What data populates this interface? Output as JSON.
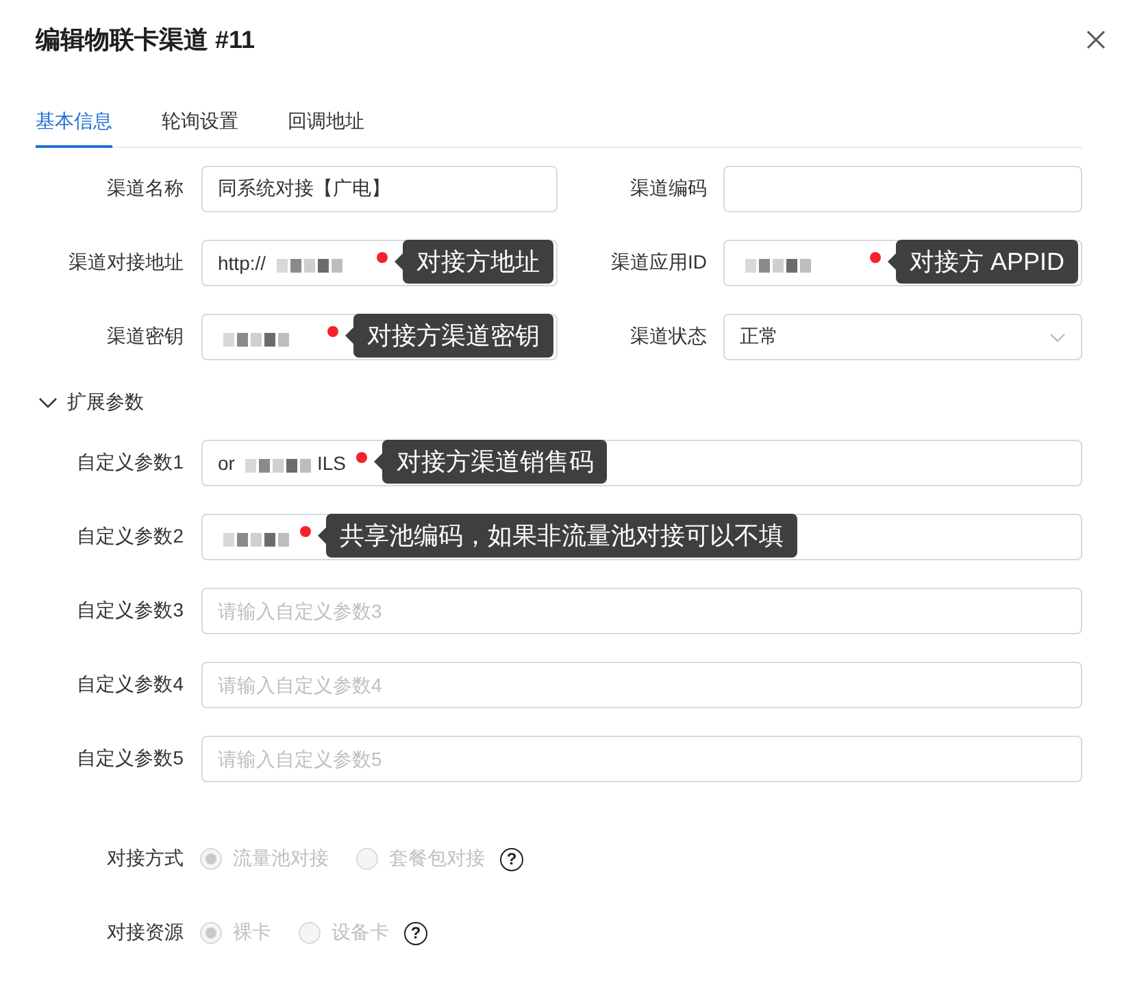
{
  "dialog": {
    "title": "编辑物联卡渠道 #11"
  },
  "tabs": [
    {
      "label": "基本信息",
      "selected": true
    },
    {
      "label": "轮询设置",
      "selected": false
    },
    {
      "label": "回调地址",
      "selected": false
    }
  ],
  "basic_fields": [
    {
      "label": "渠道名称",
      "kind": "input",
      "value": "同系统对接【广电】"
    },
    {
      "label": "渠道编码",
      "kind": "input"
    },
    {
      "label": "渠道对接地址",
      "kind": "input",
      "value_parts": [
        {
          "kind": "text",
          "text": "http://"
        },
        {
          "kind": "redacted"
        }
      ],
      "note": "对接方地址"
    },
    {
      "label": "渠道应用ID",
      "kind": "input",
      "value_parts": [
        {
          "kind": "redacted"
        }
      ],
      "note": "对接方 APPID"
    },
    {
      "label": "渠道密钥",
      "kind": "input",
      "value_parts": [
        {
          "kind": "redacted"
        }
      ],
      "note": "对接方渠道密钥"
    },
    {
      "label": "渠道状态",
      "kind": "select",
      "value": "正常"
    }
  ],
  "extension": {
    "title": "扩展参数",
    "expanded": true,
    "fields": [
      {
        "label": "自定义参数1",
        "kind": "input",
        "value_parts": [
          {
            "kind": "text",
            "text": "or"
          },
          {
            "kind": "redacted"
          },
          {
            "kind": "text",
            "text": "ILS"
          }
        ],
        "note": "对接方渠道销售码"
      },
      {
        "label": "自定义参数2",
        "kind": "input",
        "value_parts": [
          {
            "kind": "redacted"
          }
        ],
        "note": "共享池编码，如果非流量池对接可以不填"
      },
      {
        "label": "自定义参数3",
        "kind": "input",
        "placeholder": "请输入自定义参数3"
      },
      {
        "label": "自定义参数4",
        "kind": "input",
        "placeholder": "请输入自定义参数4"
      },
      {
        "label": "自定义参数5",
        "kind": "input",
        "placeholder": "请输入自定义参数5"
      }
    ]
  },
  "radio_groups": [
    {
      "label": "对接方式",
      "options": [
        {
          "label": "流量池对接",
          "selected": true,
          "disabled": true
        },
        {
          "label": "套餐包对接",
          "selected": false,
          "disabled": true
        }
      ],
      "help": "?"
    },
    {
      "label": "对接资源",
      "options": [
        {
          "label": "裸卡",
          "selected": true,
          "disabled": true
        },
        {
          "label": "设备卡",
          "selected": false,
          "disabled": true
        }
      ],
      "help": "?"
    }
  ]
}
